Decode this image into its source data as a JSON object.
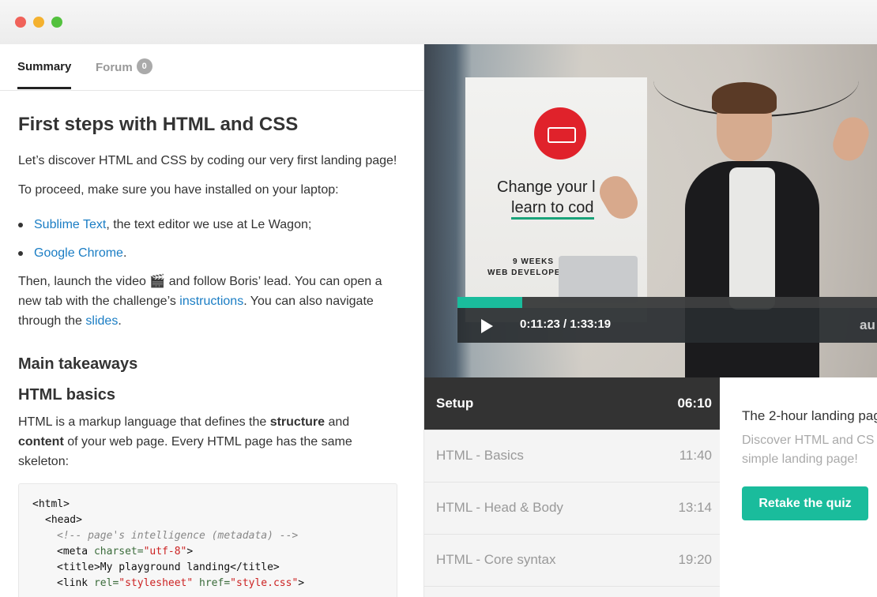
{
  "tabs": {
    "summary": "Summary",
    "forum": "Forum",
    "forum_count": "0"
  },
  "lesson": {
    "title": "First steps with HTML and CSS",
    "intro": "Let’s discover HTML and CSS by coding our very first landing page!",
    "proceed": "To proceed, make sure you have installed on your laptop:",
    "bullets": [
      {
        "link": "Sublime Text",
        "text": ", the text editor we use at Le Wagon;"
      },
      {
        "link": "Google Chrome",
        "text": "."
      }
    ],
    "then": {
      "part1": "Then, launch the video 🎬 and follow Boris’ lead. You can open a new tab with the challenge’s ",
      "link1": "instructions",
      "part2": ". You can also navigate through the ",
      "link2": "slides",
      "part3": "."
    },
    "takeaways_heading": "Main takeaways",
    "basics_heading": "HTML basics",
    "basics": {
      "a": "HTML is a markup language that defines the ",
      "b": "structure",
      "c": " and ",
      "d": "content",
      "e": " of your web page. Every HTML page has the same skeleton:"
    },
    "code": {
      "l1": "<html>",
      "l2": "<head>",
      "l3": "<!-- page's intelligence (metadata) -->",
      "l4_tag": "<meta ",
      "l4_attr": "charset=",
      "l4_str": "\"utf-8\"",
      "l4_end": ">",
      "l5": "<title>My playground landing</title>",
      "l6_tag": "<link ",
      "l6_attr1": "rel=",
      "l6_str1": "\"stylesheet\"",
      "l6_attr2": " href=",
      "l6_str2": "\"style.css\"",
      "l6_end": ">"
    }
  },
  "video": {
    "banner_line1": "Change your l",
    "banner_line2": "learn to cod",
    "banner_line3": "9 WEEKS",
    "banner_line4": "WEB DEVELOPE          N",
    "time": "0:11:23 / 1:33:19",
    "progress": 0.155,
    "right_label": "au"
  },
  "chapters": [
    {
      "name": "Setup",
      "time": "06:10",
      "active": true
    },
    {
      "name": "HTML - Basics",
      "time": "11:40"
    },
    {
      "name": "HTML - Head & Body",
      "time": "13:14"
    },
    {
      "name": "HTML - Core syntax",
      "time": "19:20"
    }
  ],
  "side": {
    "title": "The 2-hour landing pag",
    "desc1": "Discover HTML and CS",
    "desc2": "simple landing page!",
    "retake": "Retake the quiz"
  },
  "colors": {
    "accent": "#1abc9c",
    "link": "#1a7dc4"
  }
}
